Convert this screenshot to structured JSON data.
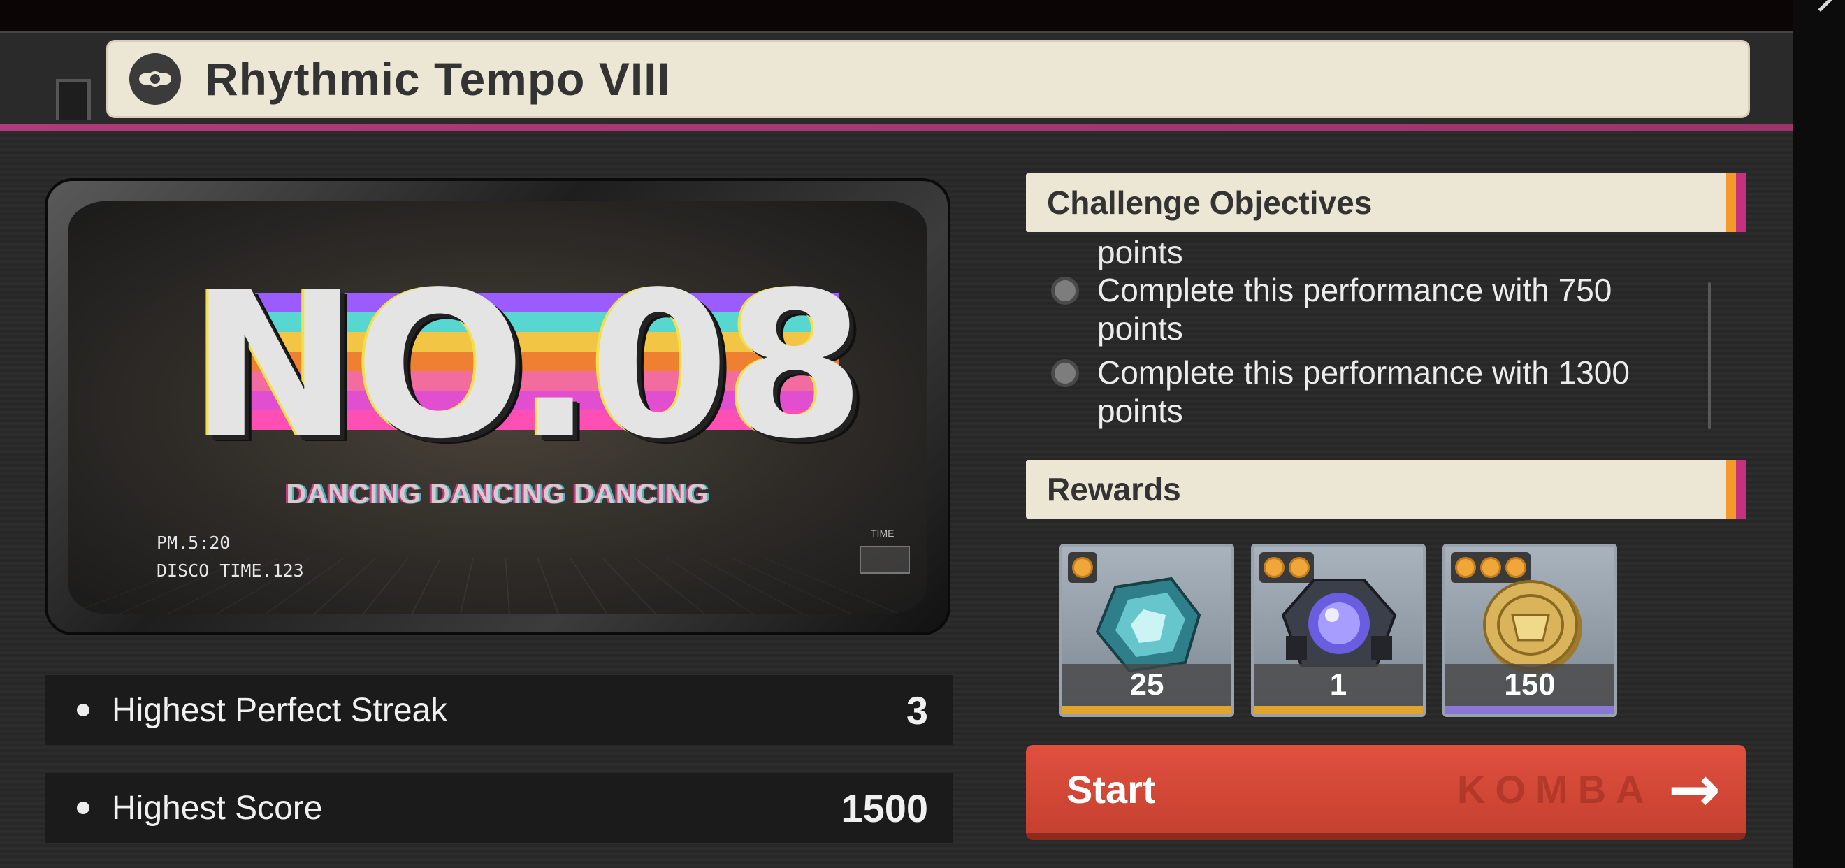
{
  "header": {
    "title": "Rhythmic Tempo VIII",
    "icon": "disc-icon"
  },
  "stage": {
    "number": "NO.08",
    "song": "DANCING DANCING DANCING",
    "clock": "PM.5:20",
    "disco_time": "DISCO TIME.123",
    "time_label": "TIME",
    "rainbow_colors": [
      "#9b5cff",
      "#58d7d0",
      "#f2c644",
      "#ef8032",
      "#f26c9f",
      "#e14fd0",
      "#ff4fb5"
    ]
  },
  "stats": [
    {
      "label": "Highest Perfect Streak",
      "value": "3"
    },
    {
      "label": "Highest Score",
      "value": "1500"
    }
  ],
  "objectives": {
    "title": "Challenge Objectives",
    "partial_text": "points",
    "items": [
      {
        "text": "Complete this performance with 750 points"
      },
      {
        "text": "Complete this performance with 1300 points"
      }
    ]
  },
  "rewards": {
    "title": "Rewards",
    "items": [
      {
        "name": "crystal-icon",
        "count": "25",
        "quality_dots": 1,
        "bar_color": "#e0a52a"
      },
      {
        "name": "orb-device-icon",
        "count": "1",
        "quality_dots": 2,
        "bar_color": "#e0a52a"
      },
      {
        "name": "gold-coin-icon",
        "count": "150",
        "quality_dots": 3,
        "bar_color": "#8a77d6"
      }
    ]
  },
  "start_button": {
    "label": "Start",
    "ghost_text": "KOMBA"
  },
  "colors": {
    "accent_magenta": "#b03a7b",
    "header_bg": "#ece6d4",
    "start_red": "#d84a38",
    "stripe_orange": "#f29a2a",
    "stripe_magenta": "#c4317f"
  }
}
